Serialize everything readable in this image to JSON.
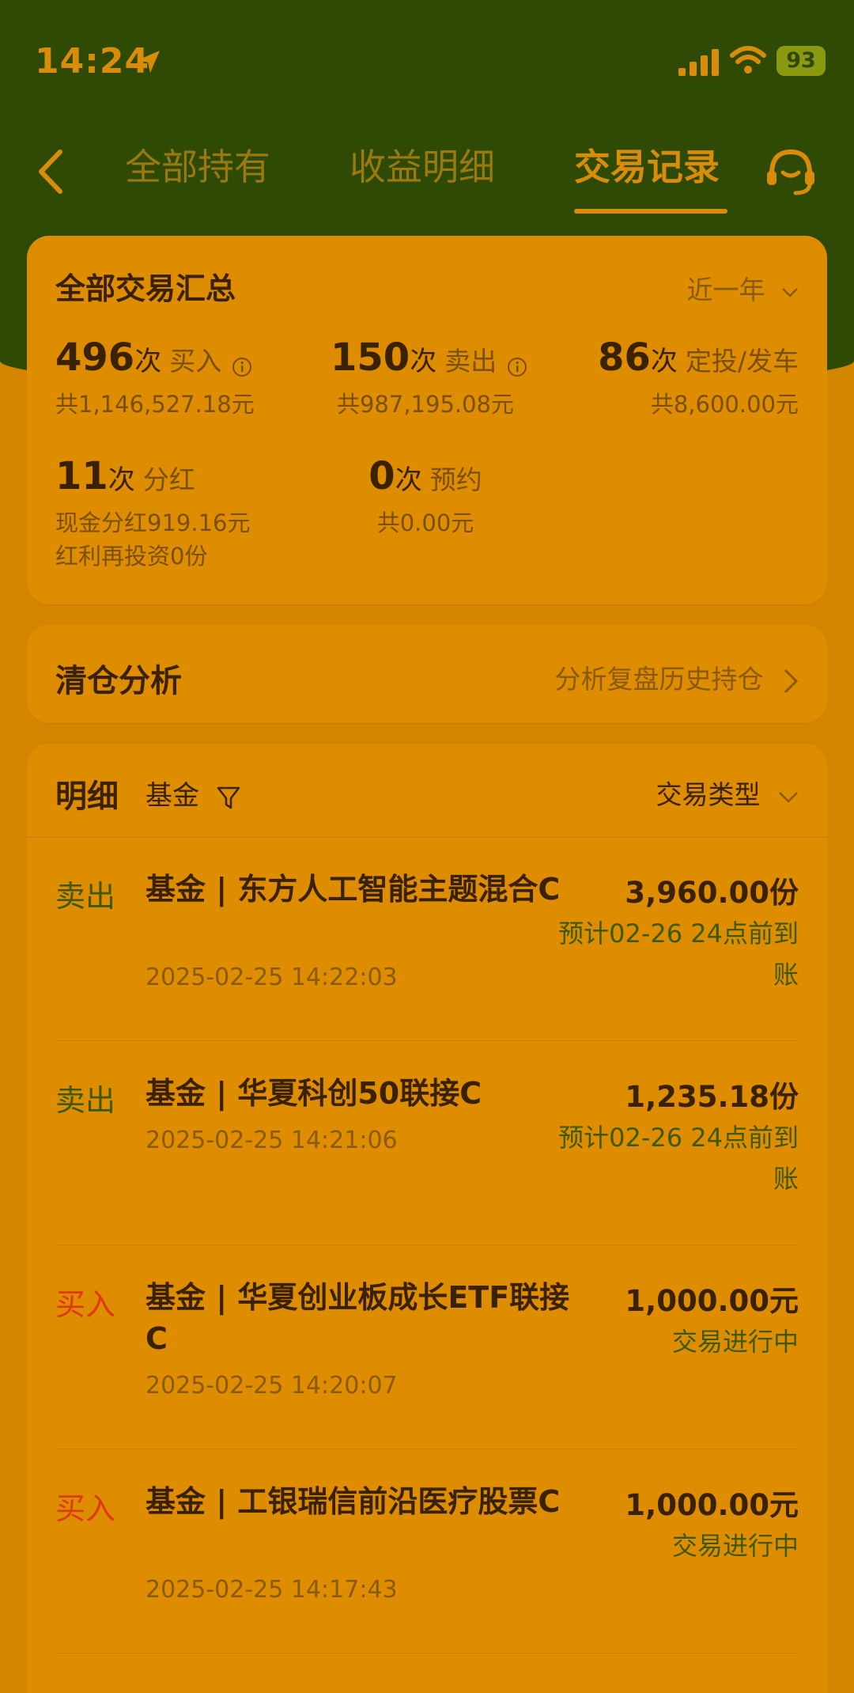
{
  "status_bar": {
    "time": "14:24",
    "battery": "93"
  },
  "nav": {
    "tabs": [
      {
        "label": "全部持有",
        "active": false
      },
      {
        "label": "收益明细",
        "active": false
      },
      {
        "label": "交易记录",
        "active": true
      }
    ]
  },
  "summary": {
    "title": "全部交易汇总",
    "period": "近一年",
    "stats": [
      {
        "count": "496",
        "unit": "次",
        "label": "买入",
        "sub": "共1,146,527.18元"
      },
      {
        "count": "150",
        "unit": "次",
        "label": "卖出",
        "sub": "共987,195.08元"
      },
      {
        "count": "86",
        "unit": "次",
        "label": "定投/发车",
        "sub": "共8,600.00元"
      },
      {
        "count": "11",
        "unit": "次",
        "label": "分红",
        "sub": "现金分红919.16元",
        "sub2": "红利再投资0份"
      },
      {
        "count": "0",
        "unit": "次",
        "label": "预约",
        "sub": "共0.00元"
      }
    ]
  },
  "clearance": {
    "title": "清仓分析",
    "link": "分析复盘历史持仓"
  },
  "detail": {
    "title": "明细",
    "filter": "基金",
    "type_filter": "交易类型",
    "rows": [
      {
        "type": "卖出",
        "name": "基金 | 东方人工智能主题混合C",
        "time": "2025-02-25 14:22:03",
        "amount": "3,960.00份",
        "status": "预计02-26 24点前到账"
      },
      {
        "type": "卖出",
        "name": "基金 | 华夏科创50联接C",
        "time": "2025-02-25 14:21:06",
        "amount": "1,235.18份",
        "status": "预计02-26 24点前到账"
      },
      {
        "type": "买入",
        "name": "基金 | 华夏创业板成长ETF联接C",
        "time": "2025-02-25 14:20:07",
        "amount": "1,000.00元",
        "status": "交易进行中"
      },
      {
        "type": "买入",
        "name": "基金 | 工银瑞信前沿医疗股票C",
        "time": "2025-02-25 14:17:43",
        "amount": "1,000.00元",
        "status": "交易进行中"
      }
    ]
  }
}
